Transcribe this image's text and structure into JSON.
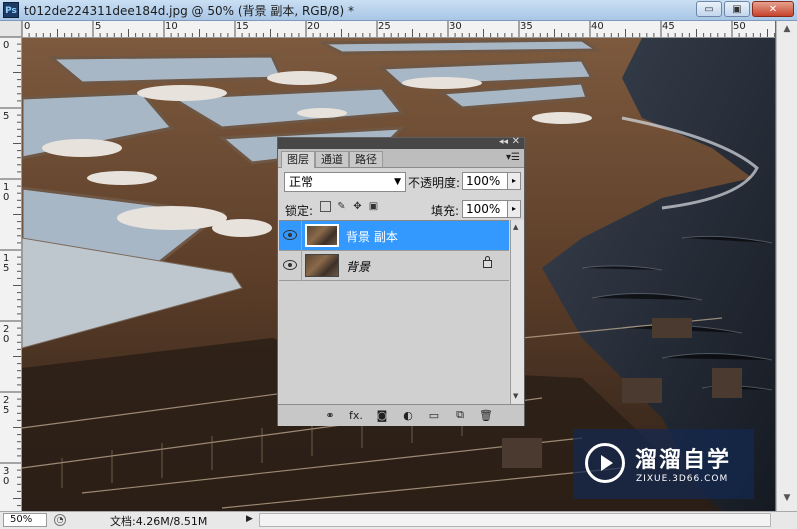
{
  "window": {
    "title": "t012de224311dee184d.jpg @ 50% (背景 副本, RGB/8) *",
    "app_icon": "Ps",
    "controls": {
      "minimize": "▭",
      "maximize": "▣",
      "close": "✕"
    }
  },
  "ruler": {
    "top_labels": [
      "0",
      "5",
      "10",
      "15",
      "20",
      "25",
      "30",
      "35",
      "40",
      "45",
      "50"
    ],
    "left_labels": [
      "0",
      "5",
      "1\n0",
      "1\n5",
      "2\n0",
      "2\n5",
      "3\n0"
    ]
  },
  "layers_panel": {
    "tabs": [
      "图层",
      "通道",
      "路径"
    ],
    "active_tab": "图层",
    "blend_mode": "正常",
    "opacity_label": "不透明度:",
    "opacity_value": "100%",
    "lock_label": "锁定:",
    "fill_label": "填充:",
    "fill_value": "100%",
    "layers": [
      {
        "name": "背景 副本",
        "selected": true,
        "visible": true,
        "locked": false
      },
      {
        "name": "背景",
        "selected": false,
        "visible": true,
        "locked": true
      }
    ],
    "bottom_icons": [
      "link-icon",
      "fx-icon",
      "mask-icon",
      "adjustment-icon",
      "group-icon",
      "new-layer-icon",
      "trash-icon"
    ],
    "fx_label": "fx."
  },
  "statusbar": {
    "zoom": "50%",
    "doc_info": "文档:4.26M/8.51M"
  },
  "watermark": {
    "title": "溜溜自学",
    "url": "ZIXUE.3D66.COM"
  },
  "colors": {
    "selection": "#3399ff",
    "titlebar": "#b7d0ec",
    "panel_bg": "#d6d6d6"
  }
}
